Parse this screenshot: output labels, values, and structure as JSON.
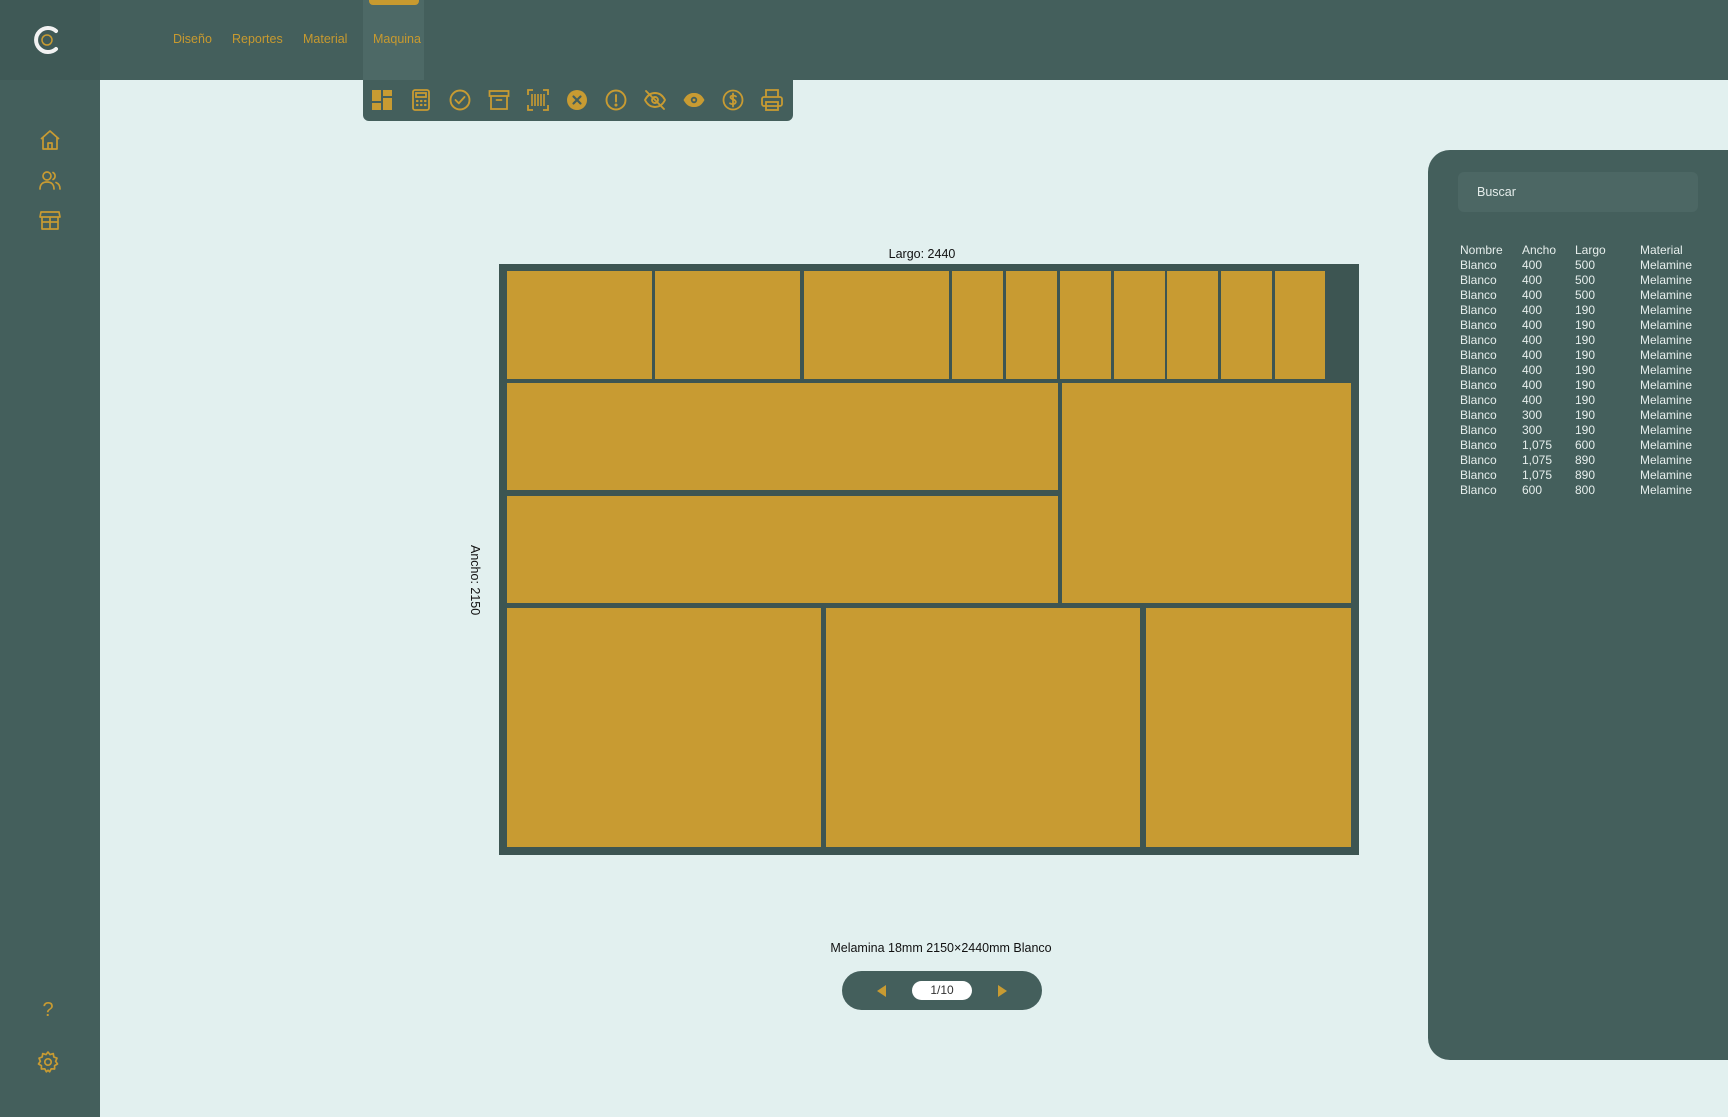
{
  "colors": {
    "accent": "#c89b32",
    "dark": "#445f5c",
    "background": "#e2f0ef",
    "board": "#3d5552"
  },
  "header": {
    "logo_icon": "logo-c-icon",
    "nav": [
      "Diseño",
      "Reportes",
      "Material",
      "Maquina"
    ],
    "active_nav": "Maquina"
  },
  "sidebar": {
    "top_icons": [
      "home-icon",
      "users-icon",
      "store-icon"
    ],
    "bottom_icons": [
      "help-icon",
      "settings-icon"
    ],
    "help_glyph": "?"
  },
  "toolbar": {
    "icons": [
      "layout-grid-icon",
      "calculator-icon",
      "check-circle-icon",
      "archive-icon",
      "barcode-scan-icon",
      "close-circle-icon",
      "alert-circle-icon",
      "eye-off-icon",
      "eye-icon",
      "dollar-circle-icon",
      "printer-icon"
    ]
  },
  "sheet": {
    "largo_label": "Largo: 2440",
    "ancho_label": "Ancho:  2150",
    "caption": "Melamina 18mm 2150×2440mm Blanco"
  },
  "pager": {
    "value": "1/10"
  },
  "panel": {
    "search_placeholder": "Buscar",
    "headers": [
      "Nombre",
      "Ancho",
      "Largo",
      "Material"
    ],
    "rows": [
      [
        "Blanco",
        "400",
        "500",
        "Melamine"
      ],
      [
        "Blanco",
        "400",
        "500",
        "Melamine"
      ],
      [
        "Blanco",
        "400",
        "500",
        "Melamine"
      ],
      [
        "Blanco",
        "400",
        "190",
        "Melamine"
      ],
      [
        "Blanco",
        "400",
        "190",
        "Melamine"
      ],
      [
        "Blanco",
        "400",
        "190",
        "Melamine"
      ],
      [
        "Blanco",
        "400",
        "190",
        "Melamine"
      ],
      [
        "Blanco",
        "400",
        "190",
        "Melamine"
      ],
      [
        "Blanco",
        "400",
        "190",
        "Melamine"
      ],
      [
        "Blanco",
        "400",
        "190",
        "Melamine"
      ],
      [
        "Blanco",
        "300",
        "190",
        "Melamine"
      ],
      [
        "Blanco",
        "300",
        "190",
        "Melamine"
      ],
      [
        "Blanco",
        "1,075",
        "600",
        "Melamine"
      ],
      [
        "Blanco",
        "1,075",
        "890",
        "Melamine"
      ],
      [
        "Blanco",
        "1,075",
        "890",
        "Melamine"
      ],
      [
        "Blanco",
        "600",
        "800",
        "Melamine"
      ]
    ]
  }
}
